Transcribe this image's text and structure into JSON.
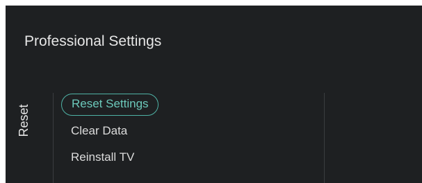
{
  "header": {
    "title": "Professional Settings"
  },
  "section": {
    "label": "Reset"
  },
  "menu": {
    "items": [
      {
        "label": "Reset Settings",
        "selected": true
      },
      {
        "label": "Clear Data",
        "selected": false
      },
      {
        "label": "Reinstall TV",
        "selected": false
      }
    ]
  },
  "colors": {
    "background": "#1e2022",
    "text": "#e6e6e6",
    "accent": "#4fb3a6",
    "divider": "#3a3d40"
  }
}
